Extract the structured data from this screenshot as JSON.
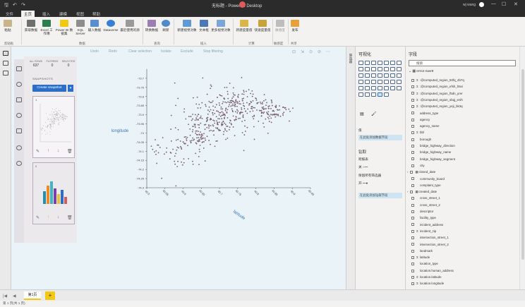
{
  "titlebar": {
    "title": "无标题 - Power BI Desktop",
    "user": "wj wang",
    "undo": "↶",
    "redo": "↷",
    "save": "🖫",
    "min": "—",
    "max": "☐",
    "close": "✕"
  },
  "tabs": [
    "文件",
    "主页",
    "插入",
    "建模",
    "视图",
    "帮助"
  ],
  "ribbon": {
    "buttons": [
      "粘贴",
      "获取数据",
      "Excel 工作簿",
      "Power BI 数据集",
      "SQL Server",
      "输入数据",
      "Dataverse",
      "最近使用的源",
      "转换数据",
      "刷新",
      "新建视觉对象",
      "文本框",
      "更多视觉对象",
      "新建度量值",
      "快速度量值",
      "敏感度",
      "发布"
    ],
    "groups": [
      "剪贴板",
      "数据",
      "查询",
      "插入",
      "计算",
      "敏感度",
      "共享"
    ]
  },
  "snapshots": {
    "stats": [
      {
        "label": "ALL ROWS",
        "value": "637"
      },
      {
        "label": "FILTERED",
        "value": "0"
      },
      {
        "label": "SELECTED",
        "value": "0"
      }
    ],
    "title": "SNAPSHOTS",
    "create_label": "Create snapshot",
    "dropdown": "▾",
    "cards": [
      {
        "num": "1"
      },
      {
        "num": "2"
      }
    ],
    "actions": [
      "✎",
      "↑",
      "↓",
      "🗑"
    ]
  },
  "toolbar": {
    "undo": "Undo",
    "redo": "Redo",
    "clear": "Clear selection",
    "isolate": "Isolate",
    "exclude": "Exclude",
    "stop": "Stop filtering"
  },
  "chart_data": {
    "type": "scatter",
    "title": "",
    "xlabel": "latitude",
    "ylabel": "longitude",
    "xlim": [
      40.5,
      40.95
    ],
    "ylim": [
      -74.3,
      -73.65
    ],
    "x_ticks": [
      "40.5",
      "40.55",
      "40.6",
      "40.65",
      "40.7",
      "40.75",
      "40.8",
      "40.85",
      "40.9",
      "40.95"
    ],
    "y_ticks": [
      "-73.7",
      "-73.75",
      "-73.8",
      "-73.85",
      "-73.9",
      "-73.95",
      "-74",
      "-74.05",
      "-74.1",
      "-74.15",
      "-74.2",
      "-74.25",
      "-74.3"
    ],
    "color": "#7a5c6a",
    "clusters": [
      {
        "x": 40.68,
        "y": -73.93,
        "sx": 0.05,
        "sy": 0.07,
        "n": 200
      },
      {
        "x": 40.75,
        "y": -73.85,
        "sx": 0.04,
        "sy": 0.05,
        "n": 150
      },
      {
        "x": 40.84,
        "y": -73.88,
        "sx": 0.03,
        "sy": 0.03,
        "n": 90
      },
      {
        "x": 40.58,
        "y": -74.12,
        "sx": 0.04,
        "sy": 0.06,
        "n": 50
      },
      {
        "x": 40.63,
        "y": -74.04,
        "sx": 0.02,
        "sy": 0.03,
        "n": 40
      }
    ]
  },
  "viz": {
    "title": "可视化",
    "side": "筛选器",
    "values_label": "值",
    "values_placeholder": "在此处添加数据字段",
    "drill_label": "钻取",
    "cross_report": "跨报表",
    "toggle_off": "关",
    "keep_filters": "保留所有筛选器",
    "toggle_on": "开",
    "drill_placeholder": "在此处添加钻取字段"
  },
  "fields": {
    "title": "字段",
    "search_placeholder": "搜索",
    "table": "erm2-nwe9",
    "items": [
      {
        "name": ":@computed_region_92fq_4b7q",
        "sigma": true
      },
      {
        "name": ":@computed_region_efsh_h5xi",
        "sigma": true
      },
      {
        "name": ":@computed_region_f5dn_yrer",
        "sigma": true
      },
      {
        "name": ":@computed_region_sbqj_enih",
        "sigma": true
      },
      {
        "name": ":@computed_region_yeji_bk3q",
        "sigma": true
      },
      {
        "name": "address_type",
        "sigma": false
      },
      {
        "name": "agency",
        "sigma": false
      },
      {
        "name": "agency_name",
        "sigma": false
      },
      {
        "name": "bbl",
        "sigma": true
      },
      {
        "name": "borough",
        "sigma": false
      },
      {
        "name": "bridge_highway_direction",
        "sigma": false
      },
      {
        "name": "bridge_highway_name",
        "sigma": false
      },
      {
        "name": "bridge_highway_segment",
        "sigma": false
      },
      {
        "name": "city",
        "sigma": false
      },
      {
        "name": "closed_date",
        "sigma": false,
        "date": true
      },
      {
        "name": "community_board",
        "sigma": false
      },
      {
        "name": "complaint_type",
        "sigma": false
      },
      {
        "name": "created_date",
        "sigma": false,
        "date": true
      },
      {
        "name": "cross_street_1",
        "sigma": false
      },
      {
        "name": "cross_street_2",
        "sigma": false
      },
      {
        "name": "descriptor",
        "sigma": false
      },
      {
        "name": "facility_type",
        "sigma": false
      },
      {
        "name": "incident_address",
        "sigma": false
      },
      {
        "name": "incident_zip",
        "sigma": true
      },
      {
        "name": "intersection_street_1",
        "sigma": false
      },
      {
        "name": "intersection_street_2",
        "sigma": false
      },
      {
        "name": "landmark",
        "sigma": false
      },
      {
        "name": "latitude",
        "sigma": true
      },
      {
        "name": "location_type",
        "sigma": false
      },
      {
        "name": "location.human_address",
        "sigma": false
      },
      {
        "name": "location.latitude",
        "sigma": true
      },
      {
        "name": "location.longitude",
        "sigma": true
      }
    ]
  },
  "pages": {
    "first": "|◀",
    "prev": "◀",
    "tab": "第1页",
    "add": "+",
    "status": "第 1 页(共 1 页)"
  }
}
